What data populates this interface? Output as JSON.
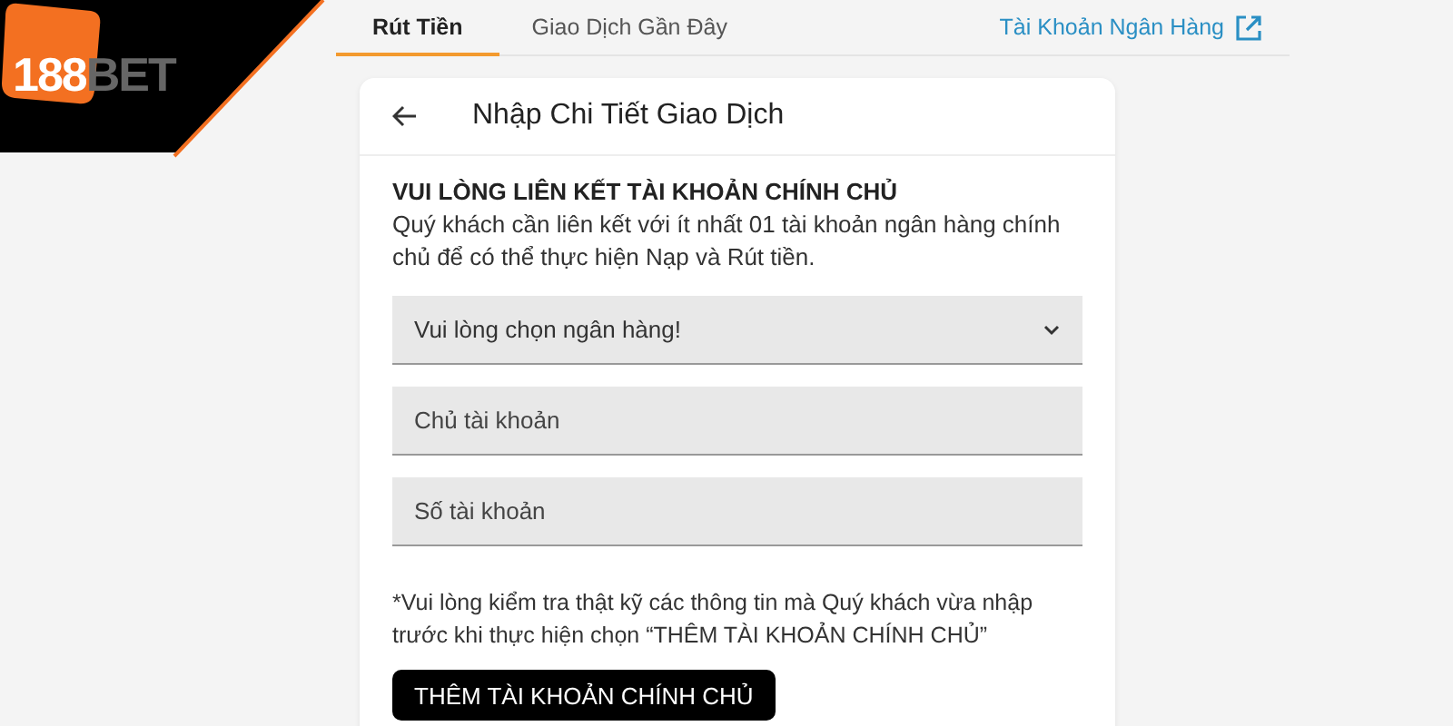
{
  "logo": {
    "number": "188",
    "word": "BET"
  },
  "tabs": [
    {
      "label": "Rút Tiền",
      "selected": true
    },
    {
      "label": "Giao Dịch Gần Đây",
      "selected": false
    }
  ],
  "bank_link": {
    "label": "Tài Khoản Ngân Hàng"
  },
  "card": {
    "title": "Nhập Chi Tiết Giao Dịch",
    "heading": "VUI LÒNG LIÊN KẾT TÀI KHOẢN CHÍNH CHỦ",
    "description": "Quý khách cần liên kết với ít nhất 01 tài khoản ngân hàng chính chủ để có thể thực hiện Nạp và Rút tiền.",
    "fields": [
      {
        "kind": "select",
        "placeholder": "Vui lòng chọn ngân hàng!"
      },
      {
        "kind": "text",
        "placeholder": "Chủ tài khoản"
      },
      {
        "kind": "text",
        "placeholder": "Số tài khoản"
      }
    ],
    "note": "*Vui lòng kiểm tra thật kỹ các thông tin mà Quý khách vừa nhập trước khi thực hiện chọn “THÊM TÀI KHOẢN CHÍNH CHỦ”",
    "button": "THÊM TÀI KHOẢN CHÍNH CHỦ"
  }
}
